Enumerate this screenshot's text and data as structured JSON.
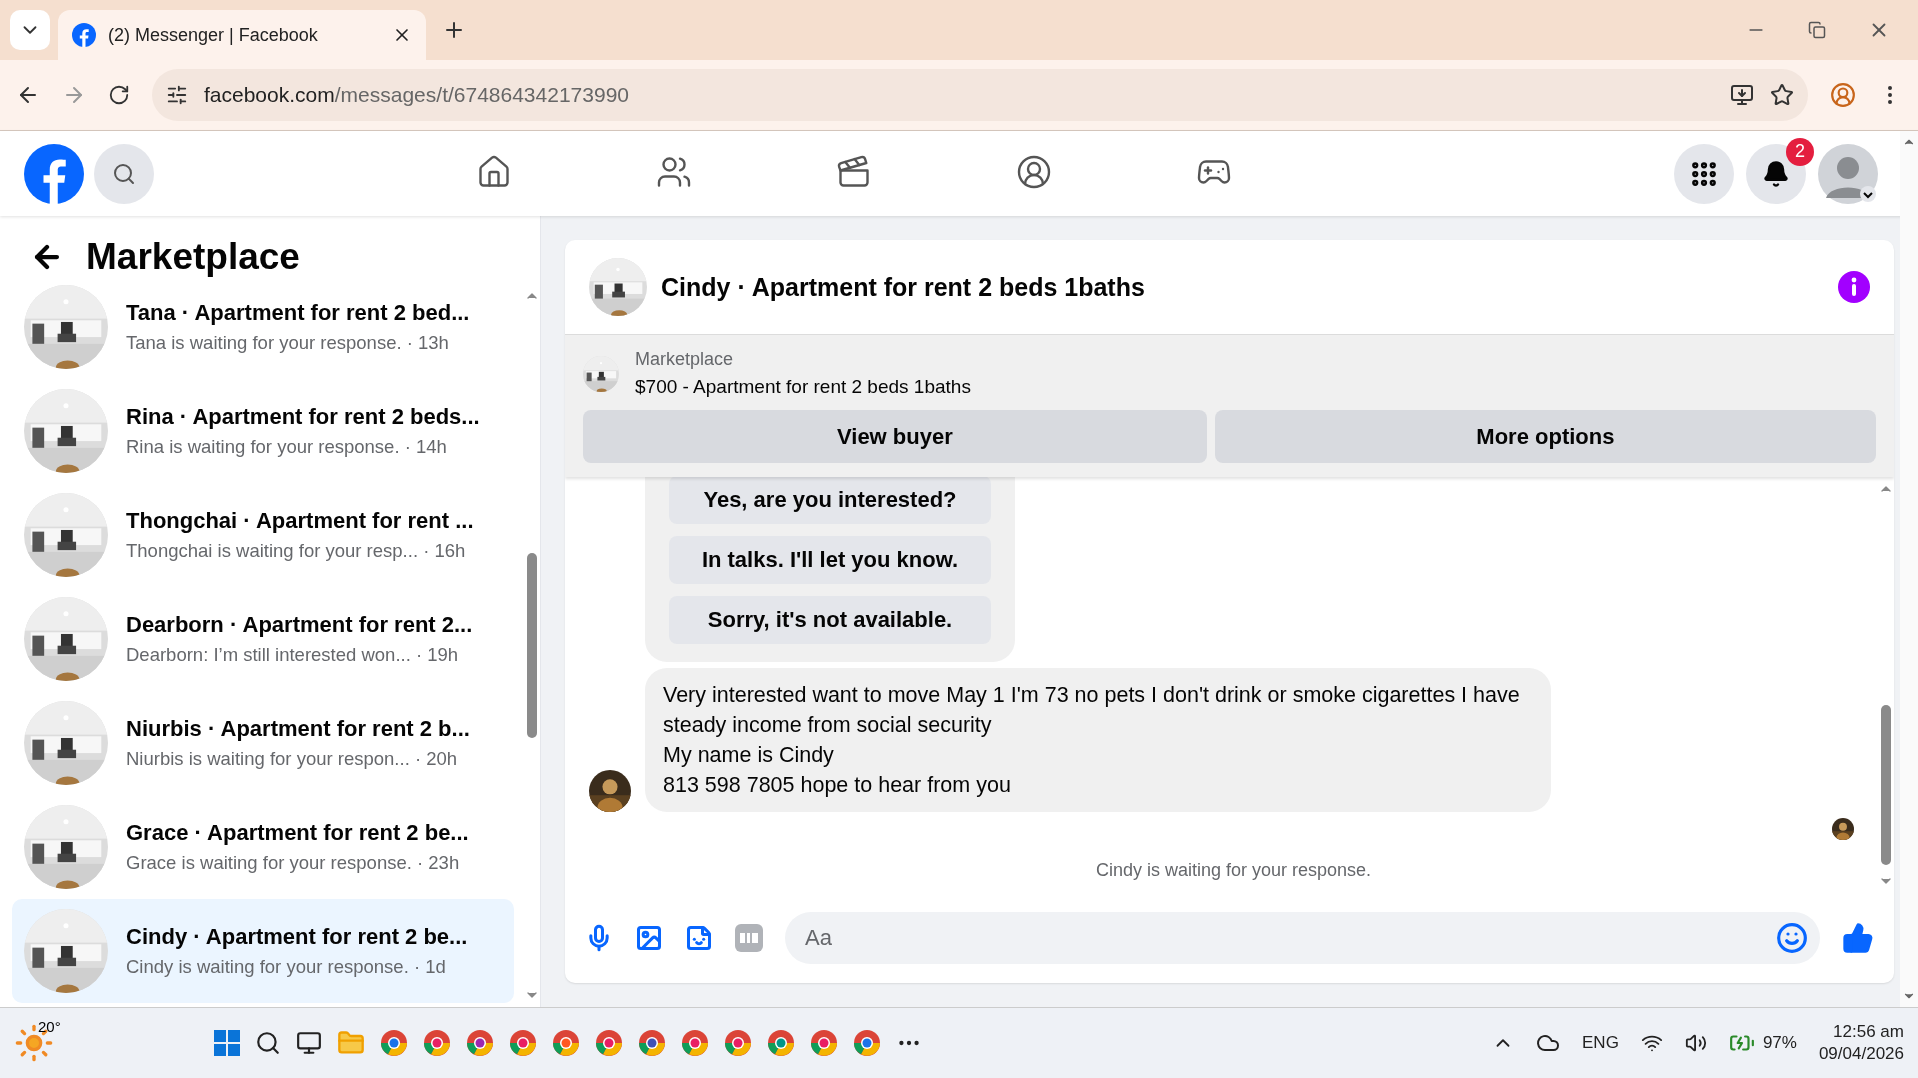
{
  "browser": {
    "tab_title": "(2) Messenger | Facebook",
    "url_domain": "facebook.com",
    "url_path": "/messages/t/674864342173990"
  },
  "header": {
    "notification_count": "2",
    "nav": [
      {
        "kind": "home",
        "selected": false
      },
      {
        "kind": "friends",
        "selected": false
      },
      {
        "kind": "video",
        "selected": false
      },
      {
        "kind": "groups",
        "selected": false
      },
      {
        "kind": "gaming",
        "selected": false
      }
    ]
  },
  "sidebar": {
    "title": "Marketplace",
    "conversations": [
      {
        "title": "Tana · Apartment for rent 2 bed...",
        "preview": "Tana is waiting for your response.",
        "time": "· 13h",
        "selected": false
      },
      {
        "title": "Rina · Apartment for rent 2 beds...",
        "preview": "Rina is waiting for your response.",
        "time": "· 14h",
        "selected": false
      },
      {
        "title": "Thongchai · Apartment for rent ...",
        "preview": "Thongchai is waiting for your resp...",
        "time": "· 16h",
        "selected": false
      },
      {
        "title": "Dearborn · Apartment for rent 2...",
        "preview": "Dearborn: I’m still interested won...",
        "time": "· 19h",
        "selected": false
      },
      {
        "title": "Niurbis · Apartment for rent 2 b...",
        "preview": "Niurbis is waiting for your respon...",
        "time": "· 20h",
        "selected": false
      },
      {
        "title": "Grace · Apartment for rent 2 be...",
        "preview": "Grace is waiting for your response.",
        "time": "· 23h",
        "selected": false
      },
      {
        "title": "Cindy · Apartment for rent 2 be...",
        "preview": "Cindy is waiting for your response.",
        "time": "· 1d",
        "selected": true
      }
    ]
  },
  "chat": {
    "title": "Cindy · Apartment for rent 2 beds 1baths",
    "listing_source": "Marketplace",
    "listing": "$700 - Apartment for rent 2 beds 1baths",
    "actions": [
      "View buyer",
      "More options"
    ],
    "quick_replies": [
      "Yes, are you interested?",
      "In talks. I'll let you know.",
      "Sorry, it's not available."
    ],
    "message_lines": [
      "Very interested want to move May 1 I'm 73 no pets I don't drink or smoke cigarettes I have steady income from social security",
      "My name is Cindy",
      "813 598 7805 hope to hear from you"
    ],
    "status": "Cindy is waiting for your response.",
    "composer": {
      "placeholder": "Aa"
    }
  },
  "taskbar": {
    "weather": "20°",
    "language": "ENG",
    "battery": "97%",
    "time": "12:56 am",
    "date": "09/04/2026"
  }
}
